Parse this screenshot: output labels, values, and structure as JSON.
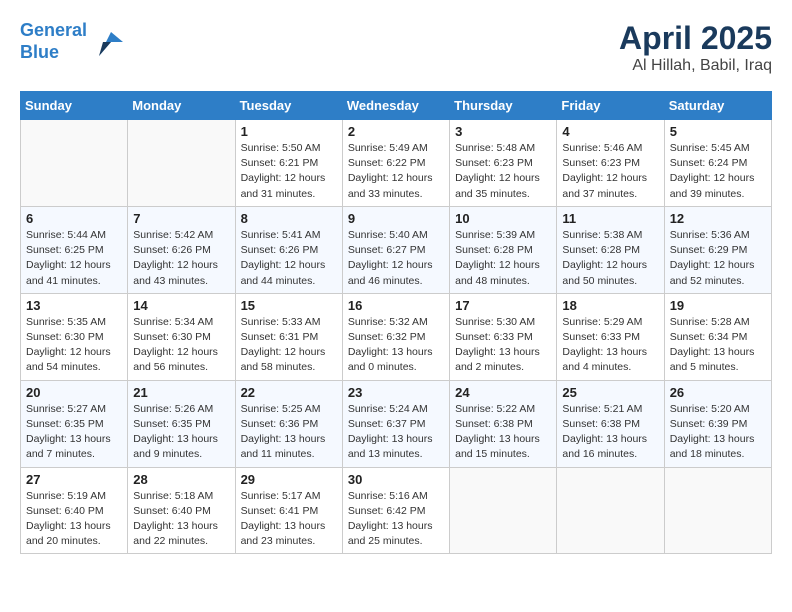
{
  "header": {
    "logo_line1": "General",
    "logo_line2": "Blue",
    "main_title": "April 2025",
    "subtitle": "Al Hillah, Babil, Iraq"
  },
  "weekdays": [
    "Sunday",
    "Monday",
    "Tuesday",
    "Wednesday",
    "Thursday",
    "Friday",
    "Saturday"
  ],
  "weeks": [
    [
      {
        "day": "",
        "sunrise": "",
        "sunset": "",
        "daylight": ""
      },
      {
        "day": "",
        "sunrise": "",
        "sunset": "",
        "daylight": ""
      },
      {
        "day": "1",
        "sunrise": "Sunrise: 5:50 AM",
        "sunset": "Sunset: 6:21 PM",
        "daylight": "Daylight: 12 hours and 31 minutes."
      },
      {
        "day": "2",
        "sunrise": "Sunrise: 5:49 AM",
        "sunset": "Sunset: 6:22 PM",
        "daylight": "Daylight: 12 hours and 33 minutes."
      },
      {
        "day": "3",
        "sunrise": "Sunrise: 5:48 AM",
        "sunset": "Sunset: 6:23 PM",
        "daylight": "Daylight: 12 hours and 35 minutes."
      },
      {
        "day": "4",
        "sunrise": "Sunrise: 5:46 AM",
        "sunset": "Sunset: 6:23 PM",
        "daylight": "Daylight: 12 hours and 37 minutes."
      },
      {
        "day": "5",
        "sunrise": "Sunrise: 5:45 AM",
        "sunset": "Sunset: 6:24 PM",
        "daylight": "Daylight: 12 hours and 39 minutes."
      }
    ],
    [
      {
        "day": "6",
        "sunrise": "Sunrise: 5:44 AM",
        "sunset": "Sunset: 6:25 PM",
        "daylight": "Daylight: 12 hours and 41 minutes."
      },
      {
        "day": "7",
        "sunrise": "Sunrise: 5:42 AM",
        "sunset": "Sunset: 6:26 PM",
        "daylight": "Daylight: 12 hours and 43 minutes."
      },
      {
        "day": "8",
        "sunrise": "Sunrise: 5:41 AM",
        "sunset": "Sunset: 6:26 PM",
        "daylight": "Daylight: 12 hours and 44 minutes."
      },
      {
        "day": "9",
        "sunrise": "Sunrise: 5:40 AM",
        "sunset": "Sunset: 6:27 PM",
        "daylight": "Daylight: 12 hours and 46 minutes."
      },
      {
        "day": "10",
        "sunrise": "Sunrise: 5:39 AM",
        "sunset": "Sunset: 6:28 PM",
        "daylight": "Daylight: 12 hours and 48 minutes."
      },
      {
        "day": "11",
        "sunrise": "Sunrise: 5:38 AM",
        "sunset": "Sunset: 6:28 PM",
        "daylight": "Daylight: 12 hours and 50 minutes."
      },
      {
        "day": "12",
        "sunrise": "Sunrise: 5:36 AM",
        "sunset": "Sunset: 6:29 PM",
        "daylight": "Daylight: 12 hours and 52 minutes."
      }
    ],
    [
      {
        "day": "13",
        "sunrise": "Sunrise: 5:35 AM",
        "sunset": "Sunset: 6:30 PM",
        "daylight": "Daylight: 12 hours and 54 minutes."
      },
      {
        "day": "14",
        "sunrise": "Sunrise: 5:34 AM",
        "sunset": "Sunset: 6:30 PM",
        "daylight": "Daylight: 12 hours and 56 minutes."
      },
      {
        "day": "15",
        "sunrise": "Sunrise: 5:33 AM",
        "sunset": "Sunset: 6:31 PM",
        "daylight": "Daylight: 12 hours and 58 minutes."
      },
      {
        "day": "16",
        "sunrise": "Sunrise: 5:32 AM",
        "sunset": "Sunset: 6:32 PM",
        "daylight": "Daylight: 13 hours and 0 minutes."
      },
      {
        "day": "17",
        "sunrise": "Sunrise: 5:30 AM",
        "sunset": "Sunset: 6:33 PM",
        "daylight": "Daylight: 13 hours and 2 minutes."
      },
      {
        "day": "18",
        "sunrise": "Sunrise: 5:29 AM",
        "sunset": "Sunset: 6:33 PM",
        "daylight": "Daylight: 13 hours and 4 minutes."
      },
      {
        "day": "19",
        "sunrise": "Sunrise: 5:28 AM",
        "sunset": "Sunset: 6:34 PM",
        "daylight": "Daylight: 13 hours and 5 minutes."
      }
    ],
    [
      {
        "day": "20",
        "sunrise": "Sunrise: 5:27 AM",
        "sunset": "Sunset: 6:35 PM",
        "daylight": "Daylight: 13 hours and 7 minutes."
      },
      {
        "day": "21",
        "sunrise": "Sunrise: 5:26 AM",
        "sunset": "Sunset: 6:35 PM",
        "daylight": "Daylight: 13 hours and 9 minutes."
      },
      {
        "day": "22",
        "sunrise": "Sunrise: 5:25 AM",
        "sunset": "Sunset: 6:36 PM",
        "daylight": "Daylight: 13 hours and 11 minutes."
      },
      {
        "day": "23",
        "sunrise": "Sunrise: 5:24 AM",
        "sunset": "Sunset: 6:37 PM",
        "daylight": "Daylight: 13 hours and 13 minutes."
      },
      {
        "day": "24",
        "sunrise": "Sunrise: 5:22 AM",
        "sunset": "Sunset: 6:38 PM",
        "daylight": "Daylight: 13 hours and 15 minutes."
      },
      {
        "day": "25",
        "sunrise": "Sunrise: 5:21 AM",
        "sunset": "Sunset: 6:38 PM",
        "daylight": "Daylight: 13 hours and 16 minutes."
      },
      {
        "day": "26",
        "sunrise": "Sunrise: 5:20 AM",
        "sunset": "Sunset: 6:39 PM",
        "daylight": "Daylight: 13 hours and 18 minutes."
      }
    ],
    [
      {
        "day": "27",
        "sunrise": "Sunrise: 5:19 AM",
        "sunset": "Sunset: 6:40 PM",
        "daylight": "Daylight: 13 hours and 20 minutes."
      },
      {
        "day": "28",
        "sunrise": "Sunrise: 5:18 AM",
        "sunset": "Sunset: 6:40 PM",
        "daylight": "Daylight: 13 hours and 22 minutes."
      },
      {
        "day": "29",
        "sunrise": "Sunrise: 5:17 AM",
        "sunset": "Sunset: 6:41 PM",
        "daylight": "Daylight: 13 hours and 23 minutes."
      },
      {
        "day": "30",
        "sunrise": "Sunrise: 5:16 AM",
        "sunset": "Sunset: 6:42 PM",
        "daylight": "Daylight: 13 hours and 25 minutes."
      },
      {
        "day": "",
        "sunrise": "",
        "sunset": "",
        "daylight": ""
      },
      {
        "day": "",
        "sunrise": "",
        "sunset": "",
        "daylight": ""
      },
      {
        "day": "",
        "sunrise": "",
        "sunset": "",
        "daylight": ""
      }
    ]
  ]
}
